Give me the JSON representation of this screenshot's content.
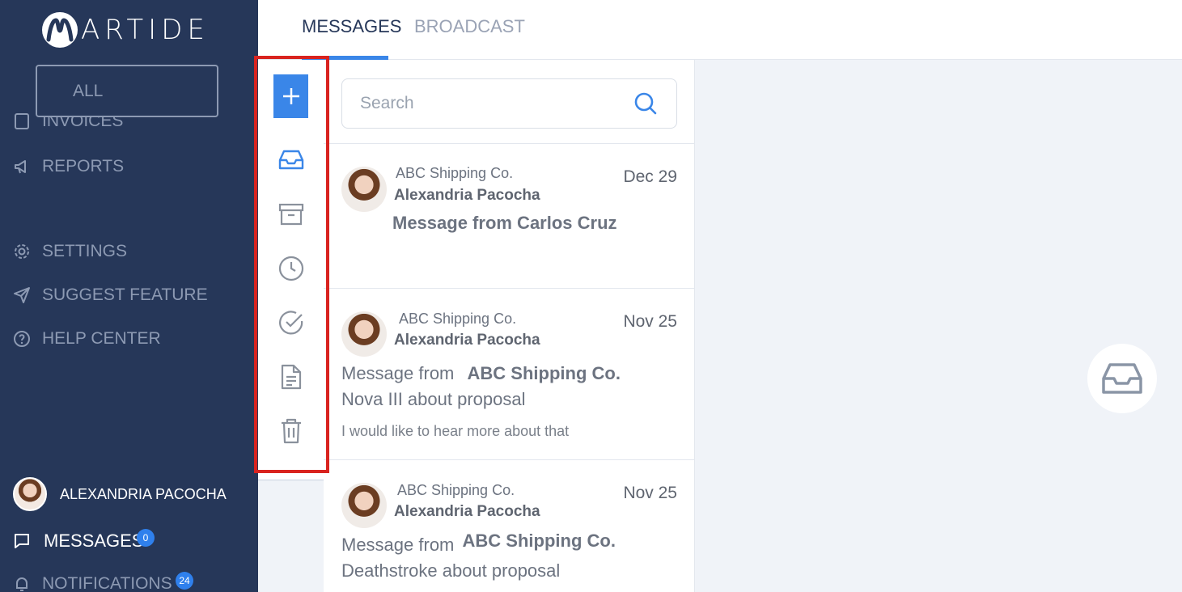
{
  "brand": {
    "name": "ARTIDE"
  },
  "sidebar": {
    "filter_button": "ALL",
    "partial_item": "INVOICES",
    "items": [
      {
        "label": "REPORTS",
        "icon": "megaphone-icon"
      },
      {
        "label": "SETTINGS",
        "icon": "gear-icon"
      },
      {
        "label": "SUGGEST FEATURE",
        "icon": "send-icon"
      },
      {
        "label": "HELP CENTER",
        "icon": "help-circle-icon"
      }
    ],
    "user_name": "ALEXANDRIA PACOCHA",
    "messages_label": "MESSAGES",
    "messages_badge": "0",
    "notifications_label": "NOTIFICATIONS",
    "notifications_badge": "24"
  },
  "tabs": [
    {
      "label": "MESSAGES",
      "active": true
    },
    {
      "label": "BROADCAST",
      "active": false
    }
  ],
  "rail": {
    "icons": [
      "plus-icon",
      "inbox-icon",
      "archive-icon",
      "clock-icon",
      "check-circle-icon",
      "document-icon",
      "trash-icon"
    ]
  },
  "search": {
    "placeholder": "Search",
    "value": ""
  },
  "messages": [
    {
      "company": "ABC Shipping Co.",
      "sender": "Alexandria Pacocha",
      "date": "Dec 29",
      "subject": "Message from Carlos Cruz",
      "preview": ""
    },
    {
      "company": "ABC Shipping Co.",
      "sender": "Alexandria Pacocha",
      "date": "Nov 25",
      "subject_line1": "Message from",
      "subject_company": "ABC Shipping Co.",
      "subject_line2": "Nova III about proposal",
      "preview": "I would like to hear more about that"
    },
    {
      "company": "ABC Shipping Co.",
      "sender": "Alexandria Pacocha",
      "date": "Nov 25",
      "subject_line1": "Message from",
      "subject_company": "ABC Shipping Co.",
      "subject_line2": "Deathstroke about proposal",
      "preview": ""
    }
  ],
  "colors": {
    "sidebar": "#263759",
    "accent": "#3a86e8",
    "highlight": "#d9231f"
  }
}
